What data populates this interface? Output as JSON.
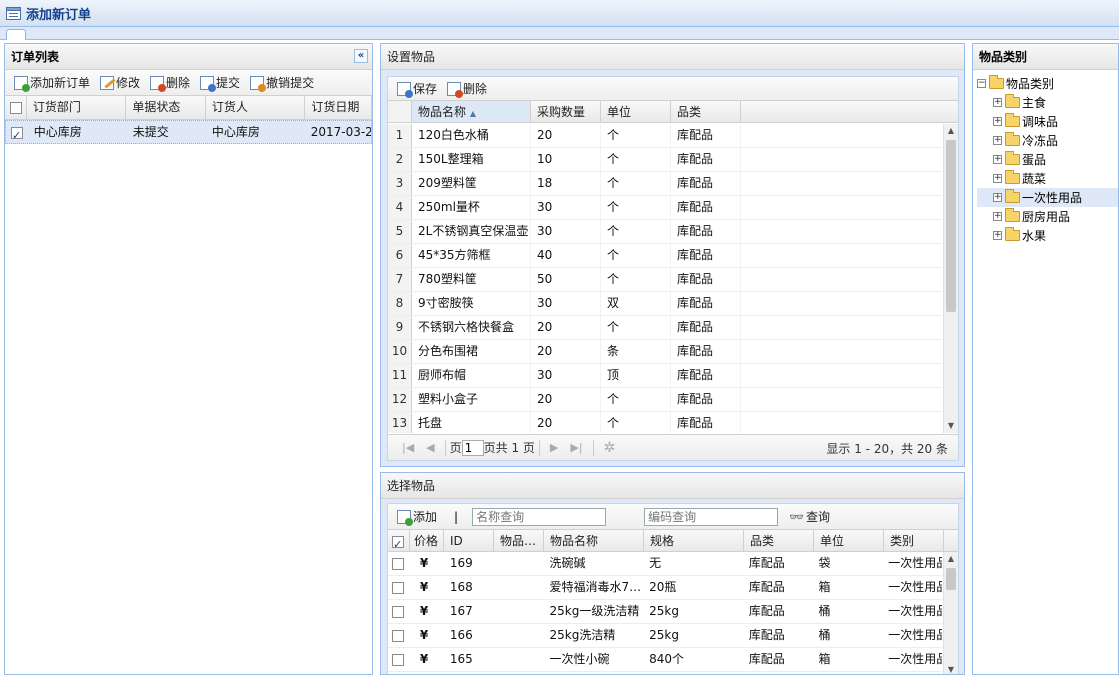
{
  "window": {
    "title": "添加新订单"
  },
  "orders_panel": {
    "title": "订单列表",
    "toolbar": [
      "添加新订单",
      "修改",
      "删除",
      "提交",
      "撤销提交"
    ],
    "columns": [
      "订货部门",
      "单据状态",
      "订货人",
      "订货日期"
    ],
    "rows": [
      {
        "checked": true,
        "dept": "中心库房",
        "status": "未提交",
        "person": "中心库房",
        "date": "2017-03-2"
      }
    ]
  },
  "settings_panel": {
    "title": "设置物品",
    "toolbar": [
      "保存",
      "删除"
    ],
    "columns": [
      "物品名称",
      "采购数量",
      "单位",
      "品类"
    ],
    "sort_indicator": "▲",
    "rows": [
      {
        "n": "1",
        "name": "120白色水桶",
        "qty": "20",
        "unit": "个",
        "cat": "库配品"
      },
      {
        "n": "2",
        "name": "150L整理箱",
        "qty": "10",
        "unit": "个",
        "cat": "库配品"
      },
      {
        "n": "3",
        "name": "209塑料筐",
        "qty": "18",
        "unit": "个",
        "cat": "库配品"
      },
      {
        "n": "4",
        "name": "250ml量杯",
        "qty": "30",
        "unit": "个",
        "cat": "库配品"
      },
      {
        "n": "5",
        "name": "2L不锈钢真空保温壶",
        "qty": "30",
        "unit": "个",
        "cat": "库配品"
      },
      {
        "n": "6",
        "name": "45*35方筛框",
        "qty": "40",
        "unit": "个",
        "cat": "库配品"
      },
      {
        "n": "7",
        "name": "780塑料筐",
        "qty": "50",
        "unit": "个",
        "cat": "库配品"
      },
      {
        "n": "8",
        "name": "9寸密胺筷",
        "qty": "30",
        "unit": "双",
        "cat": "库配品"
      },
      {
        "n": "9",
        "name": "不锈钢六格快餐盒",
        "qty": "20",
        "unit": "个",
        "cat": "库配品"
      },
      {
        "n": "10",
        "name": "分色布围裙",
        "qty": "20",
        "unit": "条",
        "cat": "库配品"
      },
      {
        "n": "11",
        "name": "厨师布帽",
        "qty": "30",
        "unit": "顶",
        "cat": "库配品"
      },
      {
        "n": "12",
        "name": "塑料小盒子",
        "qty": "20",
        "unit": "个",
        "cat": "库配品"
      },
      {
        "n": "13",
        "name": "托盘",
        "qty": "20",
        "unit": "个",
        "cat": "库配品"
      }
    ],
    "pager": {
      "page_label": "页",
      "page_value": "1",
      "total_label": "页共 1 页",
      "info": "显示 1 - 20，共 20 条"
    }
  },
  "select_panel": {
    "title": "选择物品",
    "add_label": "添加",
    "separator": "|",
    "name_placeholder": "名称查询",
    "code_placeholder": "编码查询",
    "query_label": "查询",
    "columns": [
      "价格",
      "ID",
      "物品…",
      "物品名称",
      "规格",
      "品类",
      "单位",
      "类别"
    ],
    "rows": [
      {
        "price": "¥",
        "id": "169",
        "code": "",
        "name": "洗碗碱",
        "spec": "无",
        "cat": "库配品",
        "unit": "袋",
        "type": "一次性用品"
      },
      {
        "price": "¥",
        "id": "168",
        "code": "",
        "name": "爱特福消毒水7…",
        "spec": "20瓶",
        "cat": "库配品",
        "unit": "箱",
        "type": "一次性用品"
      },
      {
        "price": "¥",
        "id": "167",
        "code": "",
        "name": "25kg一级洗洁精",
        "spec": "25kg",
        "cat": "库配品",
        "unit": "桶",
        "type": "一次性用品"
      },
      {
        "price": "¥",
        "id": "166",
        "code": "",
        "name": "25kg洗洁精",
        "spec": "25kg",
        "cat": "库配品",
        "unit": "桶",
        "type": "一次性用品"
      },
      {
        "price": "¥",
        "id": "165",
        "code": "",
        "name": "一次性小碗",
        "spec": "840个",
        "cat": "库配品",
        "unit": "箱",
        "type": "一次性用品"
      }
    ]
  },
  "category_panel": {
    "title": "物品类别",
    "root": "物品类别",
    "items": [
      "主食",
      "调味品",
      "冷冻品",
      "蛋品",
      "蔬菜",
      "一次性用品",
      "厨房用品",
      "水果"
    ],
    "selected": "一次性用品"
  }
}
